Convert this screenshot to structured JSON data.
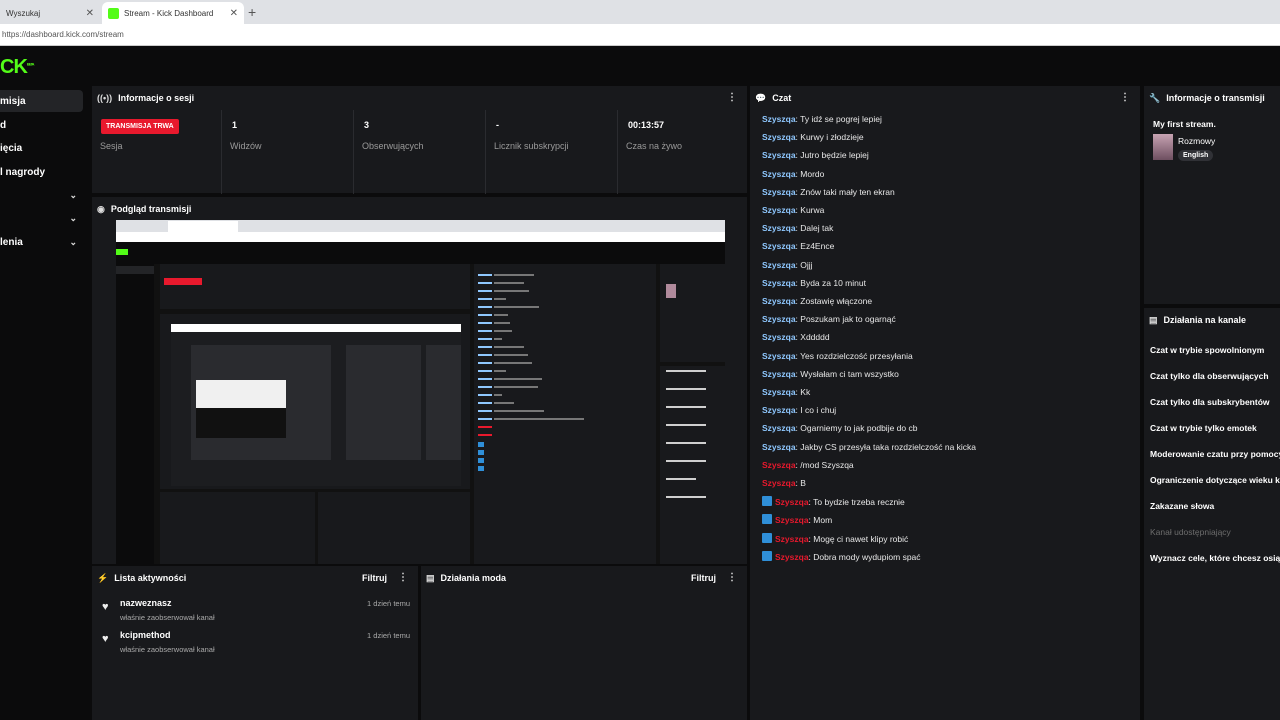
{
  "browser": {
    "tabs": [
      {
        "label": "Wyszukaj"
      },
      {
        "label": "Stream - Kick Dashboard"
      }
    ],
    "new_tab": "+",
    "url": "https://dashboard.kick.com/stream"
  },
  "logo": {
    "text": "KICK",
    "sup": "BETA"
  },
  "sidebar": {
    "items": [
      {
        "label": "misja"
      },
      {
        "label": "d"
      },
      {
        "label": "ięcia"
      },
      {
        "label": "l nagrody"
      },
      {
        "label": ""
      },
      {
        "label": ""
      },
      {
        "label": "lenia"
      }
    ],
    "chevron": "⌄"
  },
  "session": {
    "title": "Informacje o sesji",
    "stats": [
      {
        "value": "TRANSMISJA TRWA",
        "label": "Sesja"
      },
      {
        "value": "1",
        "label": "Widzów"
      },
      {
        "value": "3",
        "label": "Obserwujących"
      },
      {
        "value": "-",
        "label": "Licznik subskrypcji"
      },
      {
        "value": "00:13:57",
        "label": "Czas na żywo"
      }
    ]
  },
  "preview": {
    "title": "Podgląd transmisji"
  },
  "activity": {
    "title": "Lista aktywności",
    "filter": "Filtruj",
    "items": [
      {
        "name": "nazweznasz",
        "sub": "właśnie zaobserwował kanał",
        "time": "1 dzień temu"
      },
      {
        "name": "kcipmethod",
        "sub": "właśnie zaobserwował kanał",
        "time": "1 dzień temu"
      }
    ]
  },
  "modactions": {
    "title": "Działania moda",
    "filter": "Filtruj"
  },
  "chat": {
    "title": "Czat",
    "messages": [
      {
        "user": "Szyszqa",
        "text": "Ty idź se pogrej lepiej",
        "mod": false,
        "badge": false
      },
      {
        "user": "Szyszqa",
        "text": "Kurwy i złodzieje",
        "mod": false,
        "badge": false
      },
      {
        "user": "Szyszqa",
        "text": "Jutro będzie lepiej",
        "mod": false,
        "badge": false
      },
      {
        "user": "Szyszqa",
        "text": "Mordo",
        "mod": false,
        "badge": false
      },
      {
        "user": "Szyszqa",
        "text": "Znów taki mały ten ekran",
        "mod": false,
        "badge": false
      },
      {
        "user": "Szyszqa",
        "text": "Kurwa",
        "mod": false,
        "badge": false
      },
      {
        "user": "Szyszqa",
        "text": "Dalej tak",
        "mod": false,
        "badge": false
      },
      {
        "user": "Szyszqa",
        "text": "Ez4Ence",
        "mod": false,
        "badge": false
      },
      {
        "user": "Szyszqa",
        "text": "Ojjj",
        "mod": false,
        "badge": false
      },
      {
        "user": "Szyszqa",
        "text": "Byda za 10 minut",
        "mod": false,
        "badge": false
      },
      {
        "user": "Szyszqa",
        "text": "Zostawię włączone",
        "mod": false,
        "badge": false
      },
      {
        "user": "Szyszqa",
        "text": "Poszukam jak to ogarnąć",
        "mod": false,
        "badge": false
      },
      {
        "user": "Szyszqa",
        "text": "Xddddd",
        "mod": false,
        "badge": false
      },
      {
        "user": "Szyszqa",
        "text": "Yes rozdzielczość przesyłania",
        "mod": false,
        "badge": false
      },
      {
        "user": "Szyszqa",
        "text": "Wysłałam ci tam wszystko",
        "mod": false,
        "badge": false
      },
      {
        "user": "Szyszqa",
        "text": "Kk",
        "mod": false,
        "badge": false
      },
      {
        "user": "Szyszqa",
        "text": "I co i chuj",
        "mod": false,
        "badge": false
      },
      {
        "user": "Szyszqa",
        "text": "Ogarniemy to jak podbije do cb",
        "mod": false,
        "badge": false
      },
      {
        "user": "Szyszqa",
        "text": "Jakby CS przesyła taka rozdzielczość na kicka",
        "mod": false,
        "badge": false
      },
      {
        "user": "Szyszqa",
        "text": "/mod Szyszqa",
        "mod": true,
        "badge": false
      },
      {
        "user": "Szyszqa",
        "text": "B",
        "mod": true,
        "badge": false
      },
      {
        "user": "Szyszqa",
        "text": "To bydzie trzeba recznie",
        "mod": true,
        "badge": true
      },
      {
        "user": "Szyszqa",
        "text": "Mom",
        "mod": true,
        "badge": true
      },
      {
        "user": "Szyszqa",
        "text": "Mogę ci nawet klipy robić",
        "mod": true,
        "badge": true
      },
      {
        "user": "Szyszqa",
        "text": "Dobra mody wydupiom spać",
        "mod": true,
        "badge": true
      }
    ]
  },
  "stream_info": {
    "title": "Informacje o transmisji",
    "stream_title": "My first stream.",
    "category": "Rozmowy",
    "language": "English"
  },
  "channel_actions": {
    "title": "Działania na kanale",
    "items": [
      {
        "label": "Czat w trybie spowolnionym",
        "dim": false
      },
      {
        "label": "Czat tylko dla obserwujących",
        "dim": false
      },
      {
        "label": "Czat tylko dla subskrybentów",
        "dim": false
      },
      {
        "label": "Czat w trybie tylko emotek",
        "dim": false
      },
      {
        "label": "Moderowanie czatu przy pomocy",
        "dim": false
      },
      {
        "label": "Ograniczenie dotyczące wieku k",
        "dim": false
      },
      {
        "label": "Zakazane słowa",
        "dim": false
      },
      {
        "label": "Kanał udostępniający",
        "dim": true
      },
      {
        "label": "Wyznacz cele, które chcesz osią",
        "dim": false
      }
    ]
  },
  "colors": {
    "accent": "#53fc18",
    "live": "#e8192d",
    "panel": "#18191c",
    "username": "#8fc8ff"
  }
}
